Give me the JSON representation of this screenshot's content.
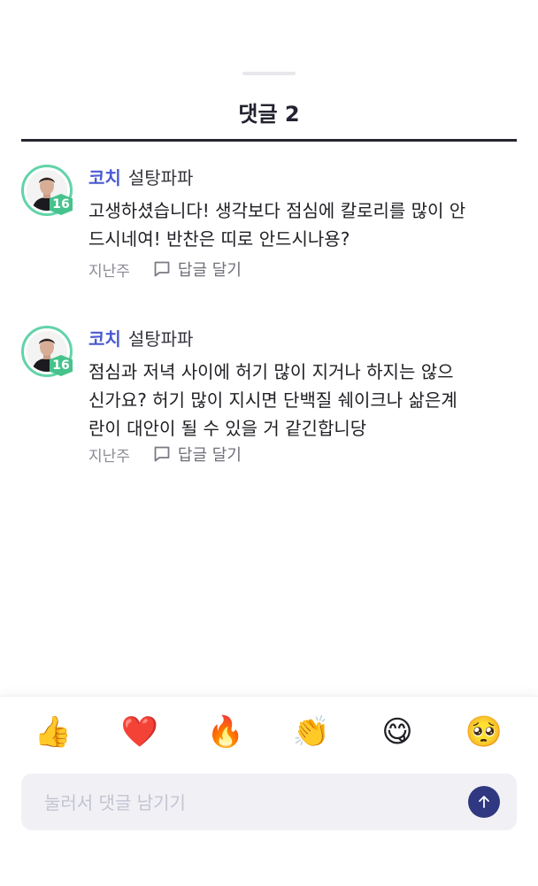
{
  "header": {
    "title": "댓글 2"
  },
  "comments": [
    {
      "role": "코치",
      "name": "설탕파파",
      "level": "16",
      "text_lines": [
        "고생하셨습니다! 생각보다 점심에 칼로리를 많이 안",
        "드시네여! 반찬은 띠로 안드시나용?"
      ],
      "time": "지난주",
      "reply_label": "답글 달기"
    },
    {
      "role": "코치",
      "name": "설탕파파",
      "level": "16",
      "text_lines": [
        "점심과 저녁 사이에 허기 많이 지거나 하지는 않으",
        "신가요? 허기 많이 지시면 단백질 쉐이크나 삶은계",
        "란이 대안이 될 수 있을 거 같긴합니당"
      ],
      "time": "지난주",
      "reply_label": "답글 달기"
    }
  ],
  "reactions": [
    {
      "emoji": "👍",
      "icon": "thumbs-up-icon"
    },
    {
      "emoji": "❤️",
      "icon": "heart-icon"
    },
    {
      "emoji": "🔥",
      "icon": "fire-icon"
    },
    {
      "emoji": "👏",
      "icon": "clapping-hands-icon"
    },
    {
      "emoji": "😋",
      "icon": "yum-face-icon"
    },
    {
      "emoji": "🥺",
      "icon": "pleading-face-icon"
    }
  ],
  "input": {
    "placeholder": "눌러서 댓글 남기기",
    "value": ""
  },
  "colors": {
    "role_accent": "#4a5ad0",
    "level_badge": "#46c38c",
    "avatar_ring": "#62d3a8",
    "send_button": "#2f3880"
  }
}
